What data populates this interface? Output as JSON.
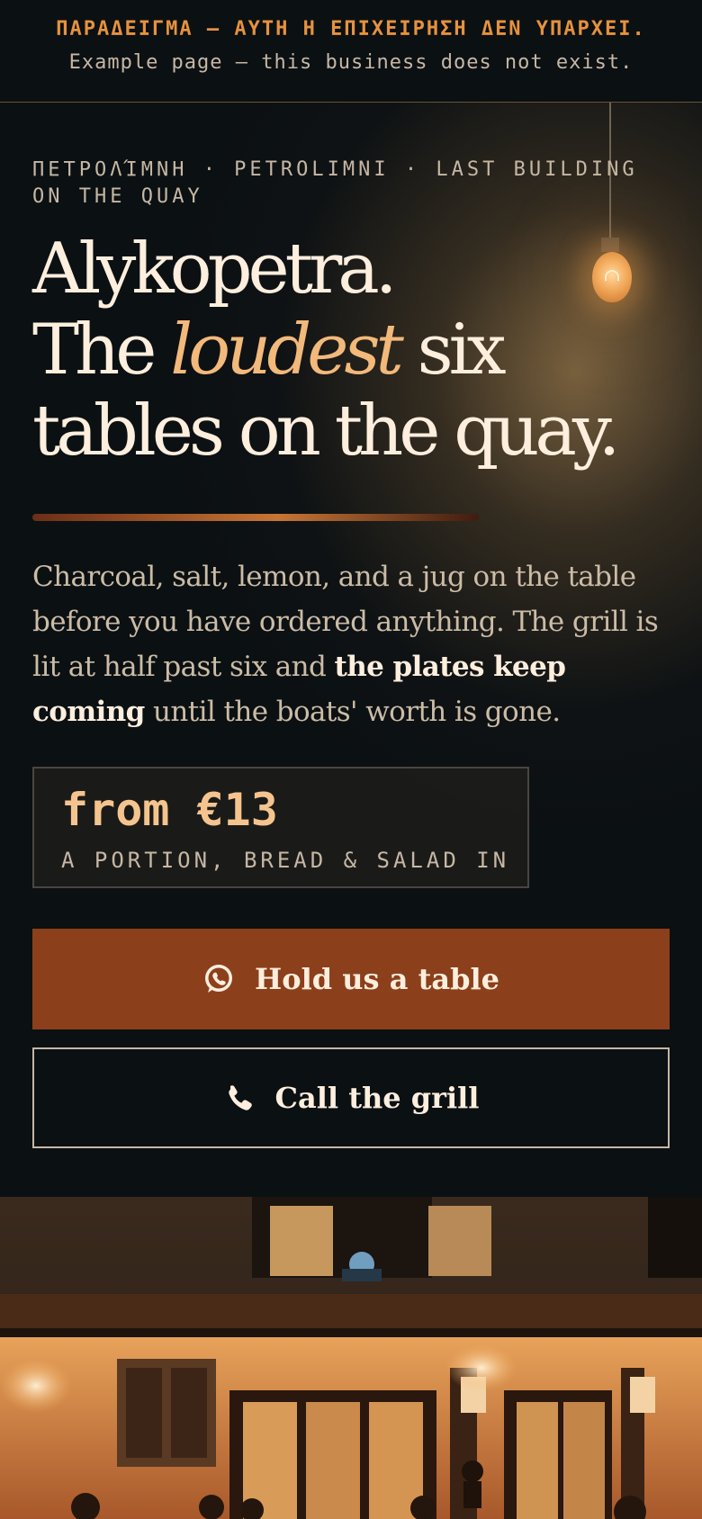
{
  "banner": {
    "greek_notice": "ΠΑΡΑΔΕΙΓΜΑ — ΑΥΤΗ Η ΕΠΙΧΕΙΡΗΣΗ ΔΕΝ ΥΠΑΡΧΕΙ.",
    "english_notice": "Example page — this business does not exist."
  },
  "hero": {
    "locale": "ΠΕΤΡΟΛΊΜΝΗ · PETROLIMNI · LAST BUILDING ON THE QUAY",
    "headline": {
      "line1": "Alykopetra.",
      "line2_before": "The ",
      "line2_emphasis": "loudest",
      "line2_after": " six",
      "line3": "tables on the quay."
    },
    "lede": {
      "part1": "Charcoal, salt, lemon, and a jug on the table before you have ordered anything. The grill is lit at half past six and ",
      "strong": "the plates keep coming",
      "part2": " until the boats' worth is gone."
    },
    "price": {
      "value": "from €13",
      "note": "A PORTION, BREAD & SALAD IN"
    }
  },
  "actions": {
    "reserve_label": "Hold us a table",
    "reserve_icon": "whatsapp-icon",
    "call_label": "Call the grill",
    "call_icon": "phone-icon"
  },
  "colors": {
    "accent": "#f2b97b",
    "warning": "#e6923f",
    "primary_button": "#8b401b",
    "background": "#0b1013"
  }
}
